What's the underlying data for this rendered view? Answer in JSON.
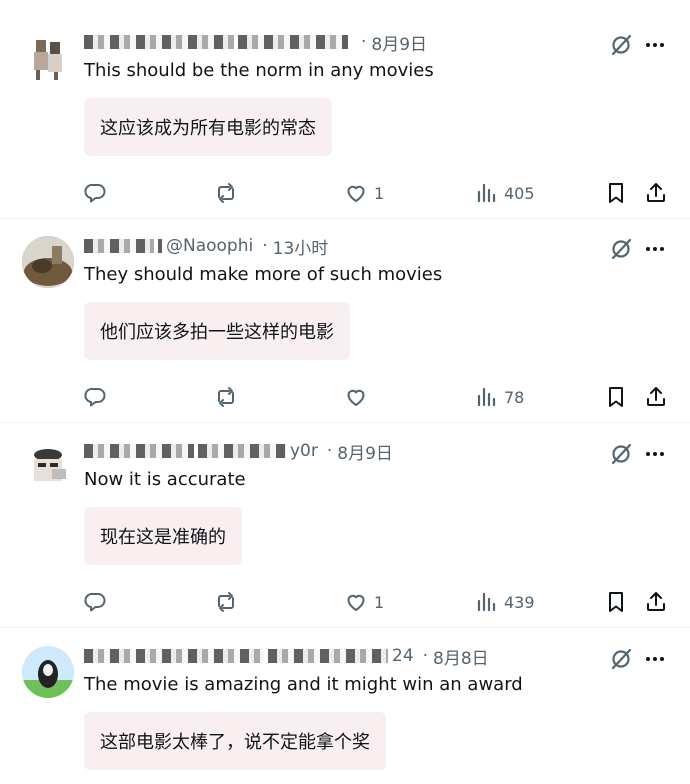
{
  "posts": [
    {
      "time": "8月9日",
      "handle_tail": "",
      "text": "This should be the norm in any movies",
      "translation": "这应该成为所有电影的常态",
      "likes": "1",
      "views": "405"
    },
    {
      "time": "13小时",
      "handle_tail": "@Naoophi",
      "text": "They should make more of such movies",
      "translation": "他们应该多拍一些这样的电影",
      "likes": "",
      "views": "78"
    },
    {
      "time": "8月9日",
      "handle_tail": "y0r",
      "text": "Now it is accurate",
      "translation": "现在这是准确的",
      "likes": "1",
      "views": "439"
    },
    {
      "time": "8月8日",
      "handle_tail": "24",
      "text": "The movie is amazing and it might win an award",
      "translation": "这部电影太棒了，说不定能拿个奖",
      "likes": "",
      "views": ""
    }
  ],
  "separator": "·",
  "icons": {
    "reply": "reply-icon",
    "repost": "repost-icon",
    "like": "heart-icon",
    "views": "views-icon",
    "bookmark": "bookmark-icon",
    "share": "share-icon",
    "grok": "grok-icon",
    "more": "more-icon"
  },
  "colors": {
    "text": "#0f1419",
    "muted": "#536471",
    "translation_bg": "#f9eff1"
  }
}
